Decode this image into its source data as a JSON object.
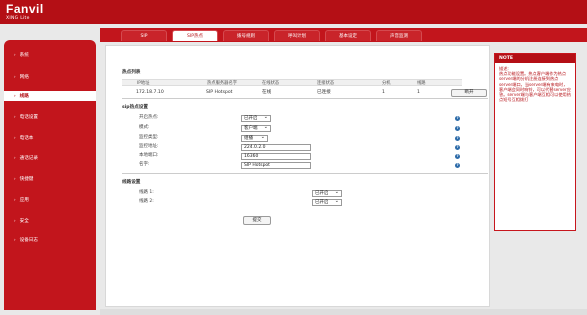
{
  "brand": {
    "name": "Fanvil",
    "tagline": "XING Lite"
  },
  "colors": {
    "accent": "#b40f15"
  },
  "sidebar": {
    "items": [
      {
        "label": "系统",
        "active": false
      },
      {
        "label": "网络",
        "active": false
      },
      {
        "label": "线路",
        "active": true
      },
      {
        "label": "电话设置",
        "active": false
      },
      {
        "label": "电话本",
        "active": false
      },
      {
        "label": "通话记录",
        "active": false
      },
      {
        "label": "快捷键",
        "active": false
      },
      {
        "label": "应用",
        "active": false
      },
      {
        "label": "安全",
        "active": false
      },
      {
        "label": "设备日志",
        "active": false
      }
    ]
  },
  "tabs": [
    {
      "label": "SIP",
      "active": false
    },
    {
      "label": "SIP热点",
      "active": true
    },
    {
      "label": "拨号规则",
      "active": false
    },
    {
      "label": "呼叫计划",
      "active": false
    },
    {
      "label": "基本设定",
      "active": false
    },
    {
      "label": "声音监测",
      "active": false
    }
  ],
  "hotspot_list": {
    "title": "热点列表",
    "columns": [
      "IP地址",
      "热点服务器名字",
      "在线状态",
      "连接状态",
      "分机",
      "线路"
    ],
    "row": {
      "ip": "172.18.7.10",
      "name": "SIP Hotspot",
      "online": "在线",
      "connect": "已连接",
      "ext": "1",
      "line": "1"
    },
    "action_label": "断开"
  },
  "sip_hotspot": {
    "title": "sip热点设置",
    "fields": [
      {
        "label": "开启热点:",
        "value": "已开启",
        "type": "select"
      },
      {
        "label": "模式:",
        "value": "客户端",
        "type": "select"
      },
      {
        "label": "监控类型:",
        "value": "组播",
        "type": "select"
      },
      {
        "label": "监控地址:",
        "value": "224.0.2.0",
        "type": "input"
      },
      {
        "label": "本地端口:",
        "value": "16360",
        "type": "input"
      },
      {
        "label": "名字:",
        "value": "SIP Hotspot",
        "type": "input"
      }
    ],
    "help_icon": "?"
  },
  "line_settings": {
    "title": "线路设置",
    "lines": [
      {
        "label": "线路 1:",
        "value": "已开启"
      },
      {
        "label": "线路 2:",
        "value": "已开启"
      }
    ]
  },
  "submit_label": "提交",
  "note": {
    "title": "NOTE",
    "heading": "描述:",
    "text": "热点功能设置。热点客户端作为热点server端的分机注册连接到热点server端口，当server端有来电时，客户端会同时响铃，可以代替server应答。server端与客户端互相可以使用热点短号互相拨打"
  }
}
